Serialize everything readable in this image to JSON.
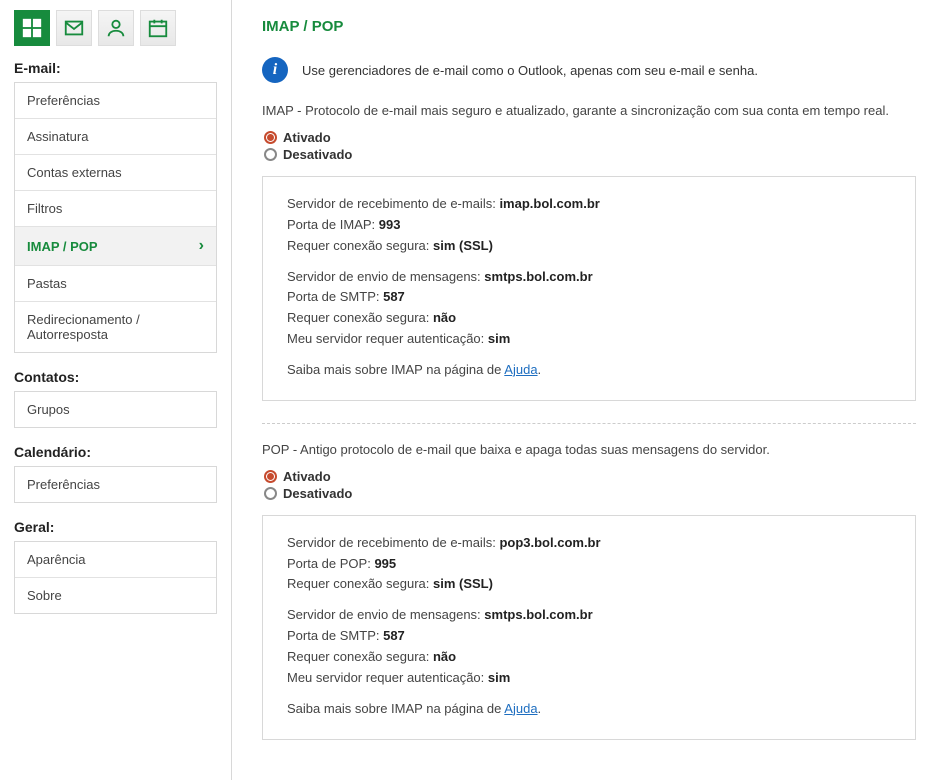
{
  "sidebar": {
    "sections": {
      "email": {
        "title": "E-mail:",
        "items": [
          {
            "label": "Preferências"
          },
          {
            "label": "Assinatura"
          },
          {
            "label": "Contas externas"
          },
          {
            "label": "Filtros"
          },
          {
            "label": "IMAP / POP",
            "active": true
          },
          {
            "label": "Pastas"
          },
          {
            "label": "Redirecionamento / Autorresposta"
          }
        ]
      },
      "contacts": {
        "title": "Contatos:",
        "items": [
          {
            "label": "Grupos"
          }
        ]
      },
      "calendar": {
        "title": "Calendário:",
        "items": [
          {
            "label": "Preferências"
          }
        ]
      },
      "general": {
        "title": "Geral:",
        "items": [
          {
            "label": "Aparência"
          },
          {
            "label": "Sobre"
          }
        ]
      }
    }
  },
  "page": {
    "title": "IMAP / POP",
    "info_text": "Use gerenciadores de e-mail como o Outlook, apenas com seu e-mail e senha.",
    "imap": {
      "desc": "IMAP - Protocolo de e-mail mais seguro e atualizado, garante a sincronização com sua conta em tempo real.",
      "radio_on": "Ativado",
      "radio_off": "Desativado",
      "rx_label": "Servidor de recebimento de e-mails: ",
      "rx_value": "imap.bol.com.br",
      "port_label": "Porta de IMAP: ",
      "port_value": "993",
      "secure_label": "Requer conexão segura: ",
      "secure_value": "sim (SSL)",
      "tx_label": "Servidor de envio de mensagens: ",
      "tx_value": "smtps.bol.com.br",
      "smtp_port_label": "Porta de SMTP: ",
      "smtp_port_value": "587",
      "tx_secure_label": "Requer conexão segura: ",
      "tx_secure_value": "não",
      "auth_label": "Meu servidor requer autenticação: ",
      "auth_value": "sim",
      "learn_more": "Saiba mais sobre IMAP na página de ",
      "help_link": "Ajuda"
    },
    "pop": {
      "desc": "POP - Antigo protocolo de e-mail que baixa e apaga todas suas mensagens do servidor.",
      "radio_on": "Ativado",
      "radio_off": "Desativado",
      "rx_label": "Servidor de recebimento de e-mails: ",
      "rx_value": "pop3.bol.com.br",
      "port_label": "Porta de POP: ",
      "port_value": "995",
      "secure_label": "Requer conexão segura: ",
      "secure_value": "sim (SSL)",
      "tx_label": "Servidor de envio de mensagens: ",
      "tx_value": "smtps.bol.com.br",
      "smtp_port_label": "Porta de SMTP: ",
      "smtp_port_value": "587",
      "tx_secure_label": "Requer conexão segura: ",
      "tx_secure_value": "não",
      "auth_label": "Meu servidor requer autenticação: ",
      "auth_value": "sim",
      "learn_more": "Saiba mais sobre IMAP na página de ",
      "help_link": "Ajuda"
    }
  }
}
